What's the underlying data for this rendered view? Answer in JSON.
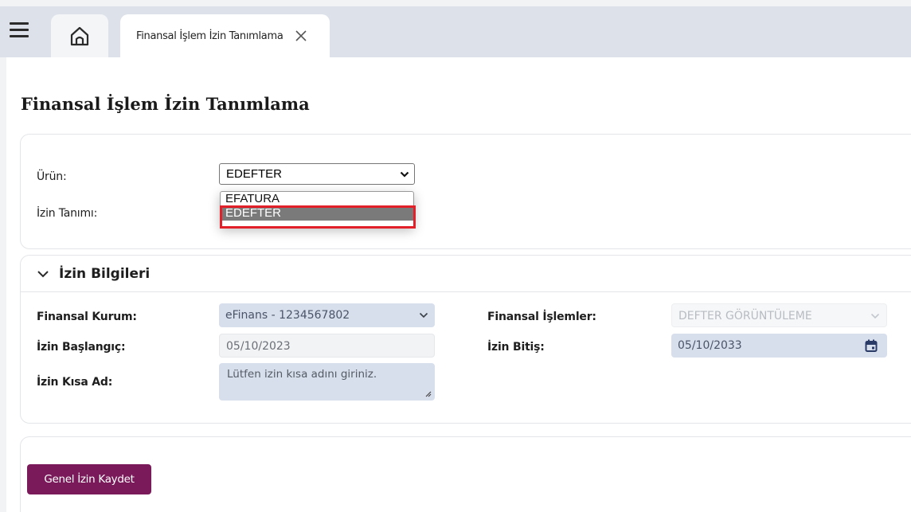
{
  "tabs": {
    "active_label": "Finansal İşlem İzin Tanımlama"
  },
  "page": {
    "title": "Finansal İşlem İzin Tanımlama"
  },
  "product": {
    "label": "Ürün:",
    "selected": "EDEFTER",
    "options": [
      "EFATURA",
      "EDEFTER"
    ],
    "highlighted_option": "EDEFTER"
  },
  "permission_definition": {
    "label": "İzin Tanımı:"
  },
  "section": {
    "title": "İzin Bilgileri"
  },
  "financial_institution": {
    "label": "Finansal Kurum:",
    "value": "eFinans - 1234567802"
  },
  "financial_operations": {
    "label": "Finansal İşlemler:",
    "value": "DEFTER GÖRÜNTÜLEME"
  },
  "start_date": {
    "label": "İzin Başlangıç:",
    "value": "05/10/2023"
  },
  "end_date": {
    "label": "İzin Bitiş:",
    "value": "05/10/2033"
  },
  "short_name": {
    "label": "İzin Kısa Ad:",
    "placeholder": "Lütfen izin kısa adını giriniz."
  },
  "actions": {
    "save_label": "Genel İzin Kaydet"
  },
  "colors": {
    "accent": "#7a1a5a",
    "highlight": "#e2202a",
    "field_bg": "#d7deec"
  }
}
